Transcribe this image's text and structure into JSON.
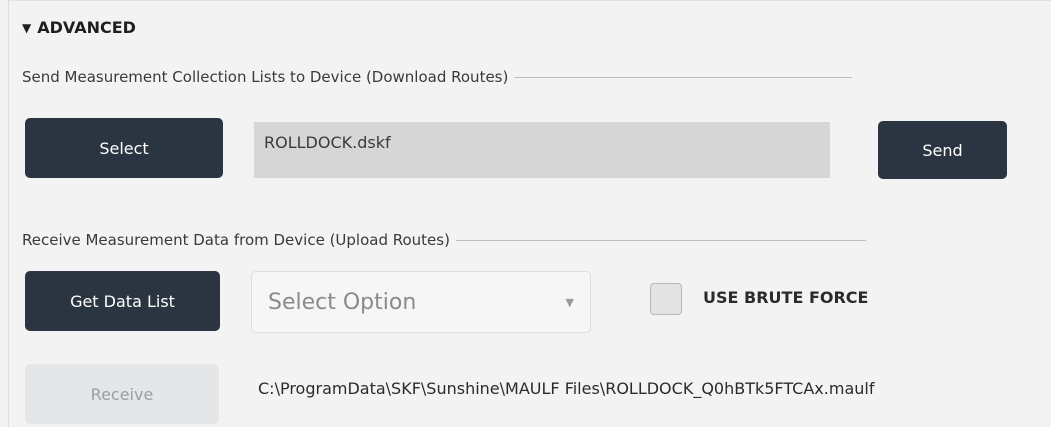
{
  "advanced": {
    "header": "ADVANCED",
    "toggle_icon": "triangle-down-icon"
  },
  "download_section": {
    "title": "Send Measurement Collection Lists to Device (Download Routes)",
    "select_button": "Select",
    "file_name": "ROLLDOCK.dskf",
    "send_button": "Send"
  },
  "upload_section": {
    "title": "Receive Measurement Data from Device (Upload Routes)",
    "get_data_button": "Get Data List",
    "select_placeholder": "Select Option",
    "brute_force_label": "USE BRUTE FORCE",
    "brute_force_checked": false,
    "receive_button": "Receive",
    "file_path": "C:\\ProgramData\\SKF\\Sunshine\\MAULF Files\\ROLLDOCK_Q0hBTk5FTCAx.maulf"
  },
  "colors": {
    "button_dark": "#2b3541",
    "button_disabled": "#e4e6e8",
    "file_box": "#d6d6d6"
  }
}
